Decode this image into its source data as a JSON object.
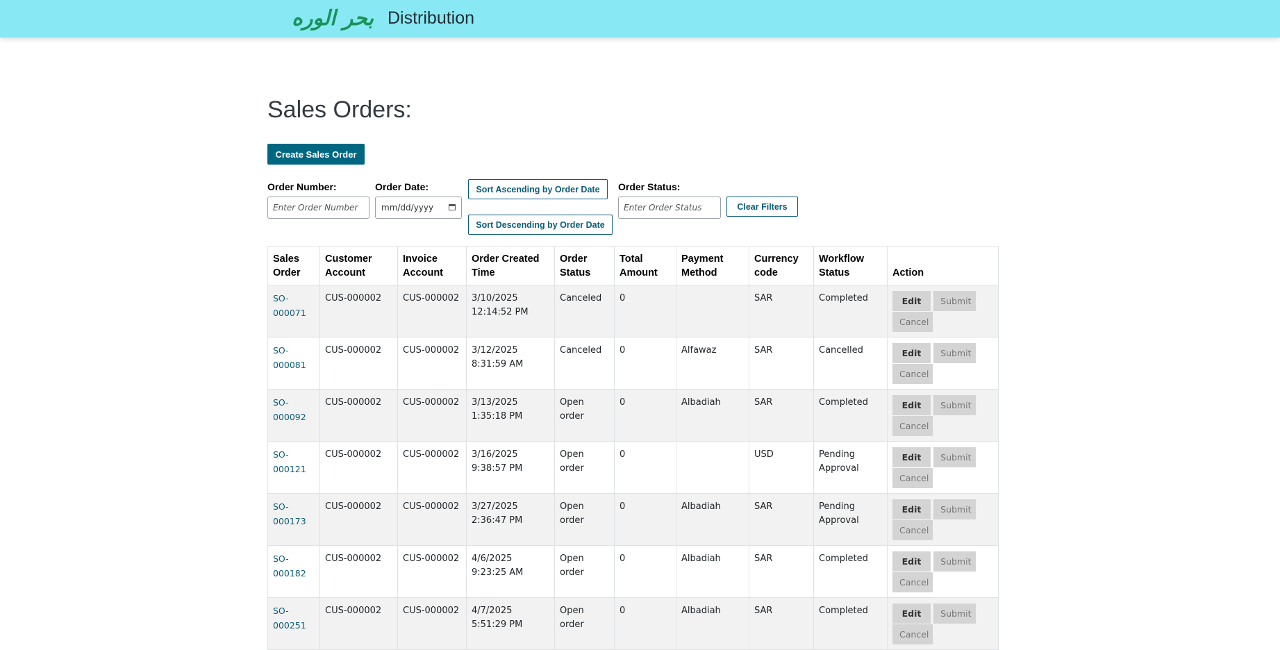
{
  "header": {
    "logo_text": "بحر الوره",
    "app_title": "Distribution"
  },
  "page": {
    "title": "Sales Orders:",
    "create_button": "Create Sales Order"
  },
  "filters": {
    "order_number_label": "Order Number:",
    "order_number_placeholder": "Enter Order Number",
    "order_date_label": "Order Date:",
    "order_date_placeholder": "mm/dd/yyyy",
    "sort_asc_label": "Sort Ascending by Order Date",
    "sort_desc_label": "Sort Descending by Order Date",
    "order_status_label": "Order Status:",
    "order_status_placeholder": "Enter Order Status",
    "clear_label": "Clear Filters"
  },
  "table": {
    "headers": [
      "Sales Order",
      "Customer Account",
      "Invoice Account",
      "Order Created Time",
      "Order Status",
      "Total Amount",
      "Payment Method",
      "Currency code",
      "Workflow Status",
      "Action"
    ],
    "action_labels": {
      "edit": "Edit",
      "submit": "Submit",
      "cancel": "Cancel"
    },
    "rows": [
      {
        "sales_order": "SO-000071",
        "customer": "CUS-000002",
        "invoice": "CUS-000002",
        "created": "3/10/2025 12:14:52 PM",
        "status": "Canceled",
        "total": "0",
        "payment": "",
        "currency": "SAR",
        "workflow": "Completed"
      },
      {
        "sales_order": "SO-000081",
        "customer": "CUS-000002",
        "invoice": "CUS-000002",
        "created": "3/12/2025 8:31:59 AM",
        "status": "Canceled",
        "total": "0",
        "payment": "Alfawaz",
        "currency": "SAR",
        "workflow": "Cancelled"
      },
      {
        "sales_order": "SO-000092",
        "customer": "CUS-000002",
        "invoice": "CUS-000002",
        "created": "3/13/2025 1:35:18 PM",
        "status": "Open order",
        "total": "0",
        "payment": "Albadiah",
        "currency": "SAR",
        "workflow": "Completed"
      },
      {
        "sales_order": "SO-000121",
        "customer": "CUS-000002",
        "invoice": "CUS-000002",
        "created": "3/16/2025 9:38:57 PM",
        "status": "Open order",
        "total": "0",
        "payment": "",
        "currency": "USD",
        "workflow": "Pending Approval"
      },
      {
        "sales_order": "SO-000173",
        "customer": "CUS-000002",
        "invoice": "CUS-000002",
        "created": "3/27/2025 2:36:47 PM",
        "status": "Open order",
        "total": "0",
        "payment": "Albadiah",
        "currency": "SAR",
        "workflow": "Pending Approval"
      },
      {
        "sales_order": "SO-000182",
        "customer": "CUS-000002",
        "invoice": "CUS-000002",
        "created": "4/6/2025 9:23:25 AM",
        "status": "Open order",
        "total": "0",
        "payment": "Albadiah",
        "currency": "SAR",
        "workflow": "Completed"
      },
      {
        "sales_order": "SO-000251",
        "customer": "CUS-000002",
        "invoice": "CUS-000002",
        "created": "4/7/2025 5:51:29 PM",
        "status": "Open order",
        "total": "0",
        "payment": "Albadiah",
        "currency": "SAR",
        "workflow": "Completed"
      }
    ]
  },
  "colors": {
    "header_bg": "#88e8f3",
    "primary": "#006780",
    "link": "#0b5c75",
    "logo": "#18925a"
  },
  "icons": {
    "calendar": "calendar-icon"
  }
}
